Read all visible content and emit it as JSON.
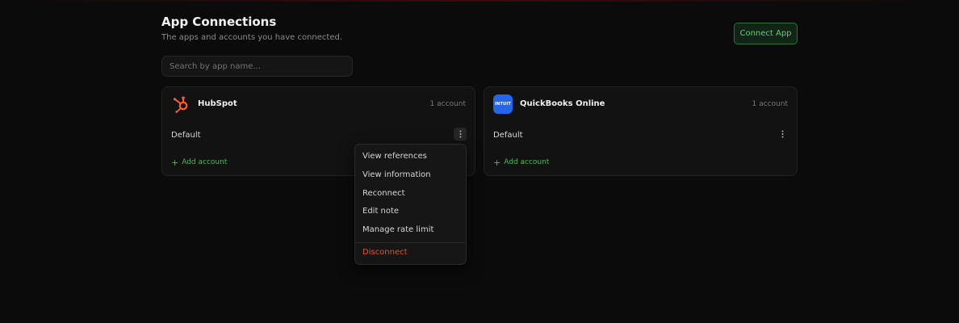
{
  "header": {
    "title": "App Connections",
    "subtitle": "The apps and accounts you have connected.",
    "connect_label": "Connect App"
  },
  "search": {
    "placeholder": "Search by app name...",
    "value": ""
  },
  "apps": [
    {
      "name": "HubSpot",
      "count": "1 account",
      "logo": "hubspot-sprocket-icon",
      "accounts": [
        {
          "name": "Default"
        }
      ],
      "add_label": "Add account"
    },
    {
      "name": "QuickBooks Online",
      "count": "1 account",
      "logo": "intuit-logo",
      "logo_text": "INTUIT",
      "accounts": [
        {
          "name": "Default"
        }
      ],
      "add_label": "Add account"
    }
  ],
  "menu": {
    "items": [
      {
        "label": "View references"
      },
      {
        "label": "View information"
      },
      {
        "label": "Reconnect"
      },
      {
        "label": "Edit note"
      },
      {
        "label": "Manage rate limit"
      },
      {
        "label": "Disconnect",
        "danger": true
      }
    ]
  },
  "colors": {
    "background": "#0b0b0b",
    "accent_green": "#5fcf74",
    "danger": "#d9553c",
    "hubspot_orange": "#ff5c35",
    "quickbooks_blue": "#2566e8"
  }
}
